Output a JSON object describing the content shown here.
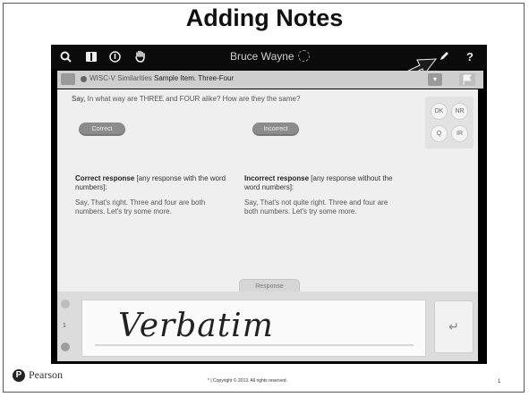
{
  "slide": {
    "title": "Adding Notes",
    "footer": "* | Copyright © 2013. All rights reserved.",
    "logo_text": "Pearson",
    "page_number": "1"
  },
  "topbar": {
    "examinee_name": "Bruce Wayne",
    "icons": [
      "magnifier-icon",
      "book-icon",
      "info-icon",
      "hand-icon",
      "pencil-icon",
      "help-icon"
    ],
    "help_label": "?"
  },
  "subbar": {
    "subtest": "WISC-V Similarities",
    "item": "Sample Item. Three-Four",
    "dropdown_glyph": "▾"
  },
  "item": {
    "prompt_say": "Say,",
    "prompt_text": "In what way are THREE and FOUR alike? How are they the same?",
    "correct_button": "Correct",
    "incorrect_button": "Incorrect",
    "quick_buttons": [
      "DK",
      "NR",
      "Q",
      "IR"
    ],
    "correct_heading": "Correct response",
    "correct_desc": "[any response with the word numbers]:",
    "correct_say": "Say, That's right. Three and four are both numbers. Let's try some more.",
    "incorrect_heading": "Incorrect response",
    "incorrect_desc": "[any response without the word numbers]:",
    "incorrect_say": "Say, That's not quite right. Three and four are both numbers. Let's try some more."
  },
  "response": {
    "tab_label": "Response",
    "handwriting": "Verbatim",
    "line_number": "1",
    "enter_glyph": "↵"
  },
  "colors": {
    "app_background": "#000000",
    "content_background": "#efefef",
    "button_gray": "#8c8c8c"
  }
}
